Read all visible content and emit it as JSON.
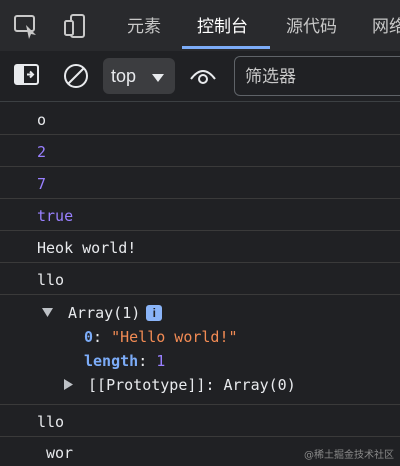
{
  "tabs": [
    {
      "label": "元素"
    },
    {
      "label": "控制台"
    },
    {
      "label": "源代码"
    },
    {
      "label": "网络"
    }
  ],
  "toolbar": {
    "context": "top",
    "filter_placeholder": "筛选器"
  },
  "console": {
    "lines": [
      "o",
      "2",
      "7",
      "true",
      "Heok world!",
      "llo"
    ],
    "array": {
      "header": "Array(1)",
      "badge": "i",
      "index_key": "0",
      "index_value": "\"Hello world!\"",
      "length_key": "length",
      "length_value": "1",
      "proto_key": "[[Prototype]]",
      "proto_value": "Array(0)"
    },
    "after_lines": [
      "llo",
      "wor"
    ]
  },
  "watermark": "@稀土掘金技术社区",
  "colors": {
    "number": "#9980ff",
    "string": "#f28b54",
    "key": "#7cacf8",
    "accent": "#7cacf8"
  }
}
